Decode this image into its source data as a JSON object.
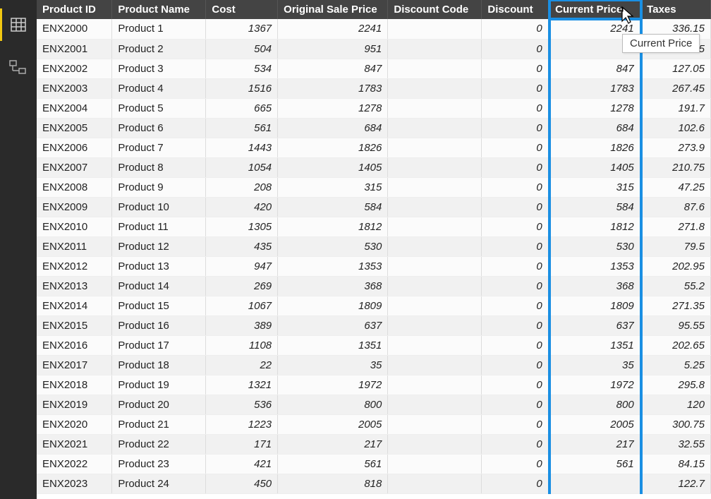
{
  "sidebar": {
    "icons": [
      "table-icon",
      "model-icon"
    ]
  },
  "tooltip": "Current Price",
  "headers": {
    "pid": "Product ID",
    "pname": "Product Name",
    "cost": "Cost",
    "osp": "Original Sale Price",
    "dcode": "Discount Code",
    "disc": "Discount",
    "cprice": "Current Price",
    "tax": "Taxes"
  },
  "rows": [
    {
      "pid": "ENX2000",
      "pname": "Product 1",
      "cost": "1367",
      "osp": "2241",
      "dcode": "",
      "disc": "0",
      "cprice": "2241",
      "tax": "336.15"
    },
    {
      "pid": "ENX2001",
      "pname": "Product 2",
      "cost": "504",
      "osp": "951",
      "dcode": "",
      "disc": "0",
      "cprice": "",
      "tax": "142.65"
    },
    {
      "pid": "ENX2002",
      "pname": "Product 3",
      "cost": "534",
      "osp": "847",
      "dcode": "",
      "disc": "0",
      "cprice": "847",
      "tax": "127.05"
    },
    {
      "pid": "ENX2003",
      "pname": "Product 4",
      "cost": "1516",
      "osp": "1783",
      "dcode": "",
      "disc": "0",
      "cprice": "1783",
      "tax": "267.45"
    },
    {
      "pid": "ENX2004",
      "pname": "Product 5",
      "cost": "665",
      "osp": "1278",
      "dcode": "",
      "disc": "0",
      "cprice": "1278",
      "tax": "191.7"
    },
    {
      "pid": "ENX2005",
      "pname": "Product 6",
      "cost": "561",
      "osp": "684",
      "dcode": "",
      "disc": "0",
      "cprice": "684",
      "tax": "102.6"
    },
    {
      "pid": "ENX2006",
      "pname": "Product 7",
      "cost": "1443",
      "osp": "1826",
      "dcode": "",
      "disc": "0",
      "cprice": "1826",
      "tax": "273.9"
    },
    {
      "pid": "ENX2007",
      "pname": "Product 8",
      "cost": "1054",
      "osp": "1405",
      "dcode": "",
      "disc": "0",
      "cprice": "1405",
      "tax": "210.75"
    },
    {
      "pid": "ENX2008",
      "pname": "Product 9",
      "cost": "208",
      "osp": "315",
      "dcode": "",
      "disc": "0",
      "cprice": "315",
      "tax": "47.25"
    },
    {
      "pid": "ENX2009",
      "pname": "Product 10",
      "cost": "420",
      "osp": "584",
      "dcode": "",
      "disc": "0",
      "cprice": "584",
      "tax": "87.6"
    },
    {
      "pid": "ENX2010",
      "pname": "Product 11",
      "cost": "1305",
      "osp": "1812",
      "dcode": "",
      "disc": "0",
      "cprice": "1812",
      "tax": "271.8"
    },
    {
      "pid": "ENX2011",
      "pname": "Product 12",
      "cost": "435",
      "osp": "530",
      "dcode": "",
      "disc": "0",
      "cprice": "530",
      "tax": "79.5"
    },
    {
      "pid": "ENX2012",
      "pname": "Product 13",
      "cost": "947",
      "osp": "1353",
      "dcode": "",
      "disc": "0",
      "cprice": "1353",
      "tax": "202.95"
    },
    {
      "pid": "ENX2013",
      "pname": "Product 14",
      "cost": "269",
      "osp": "368",
      "dcode": "",
      "disc": "0",
      "cprice": "368",
      "tax": "55.2"
    },
    {
      "pid": "ENX2014",
      "pname": "Product 15",
      "cost": "1067",
      "osp": "1809",
      "dcode": "",
      "disc": "0",
      "cprice": "1809",
      "tax": "271.35"
    },
    {
      "pid": "ENX2015",
      "pname": "Product 16",
      "cost": "389",
      "osp": "637",
      "dcode": "",
      "disc": "0",
      "cprice": "637",
      "tax": "95.55"
    },
    {
      "pid": "ENX2016",
      "pname": "Product 17",
      "cost": "1108",
      "osp": "1351",
      "dcode": "",
      "disc": "0",
      "cprice": "1351",
      "tax": "202.65"
    },
    {
      "pid": "ENX2017",
      "pname": "Product 18",
      "cost": "22",
      "osp": "35",
      "dcode": "",
      "disc": "0",
      "cprice": "35",
      "tax": "5.25"
    },
    {
      "pid": "ENX2018",
      "pname": "Product 19",
      "cost": "1321",
      "osp": "1972",
      "dcode": "",
      "disc": "0",
      "cprice": "1972",
      "tax": "295.8"
    },
    {
      "pid": "ENX2019",
      "pname": "Product 20",
      "cost": "536",
      "osp": "800",
      "dcode": "",
      "disc": "0",
      "cprice": "800",
      "tax": "120"
    },
    {
      "pid": "ENX2020",
      "pname": "Product 21",
      "cost": "1223",
      "osp": "2005",
      "dcode": "",
      "disc": "0",
      "cprice": "2005",
      "tax": "300.75"
    },
    {
      "pid": "ENX2021",
      "pname": "Product 22",
      "cost": "171",
      "osp": "217",
      "dcode": "",
      "disc": "0",
      "cprice": "217",
      "tax": "32.55"
    },
    {
      "pid": "ENX2022",
      "pname": "Product 23",
      "cost": "421",
      "osp": "561",
      "dcode": "",
      "disc": "0",
      "cprice": "561",
      "tax": "84.15"
    },
    {
      "pid": "ENX2023",
      "pname": "Product 24",
      "cost": "450",
      "osp": "818",
      "dcode": "",
      "disc": "0",
      "cprice": "",
      "tax": "122.7"
    }
  ]
}
